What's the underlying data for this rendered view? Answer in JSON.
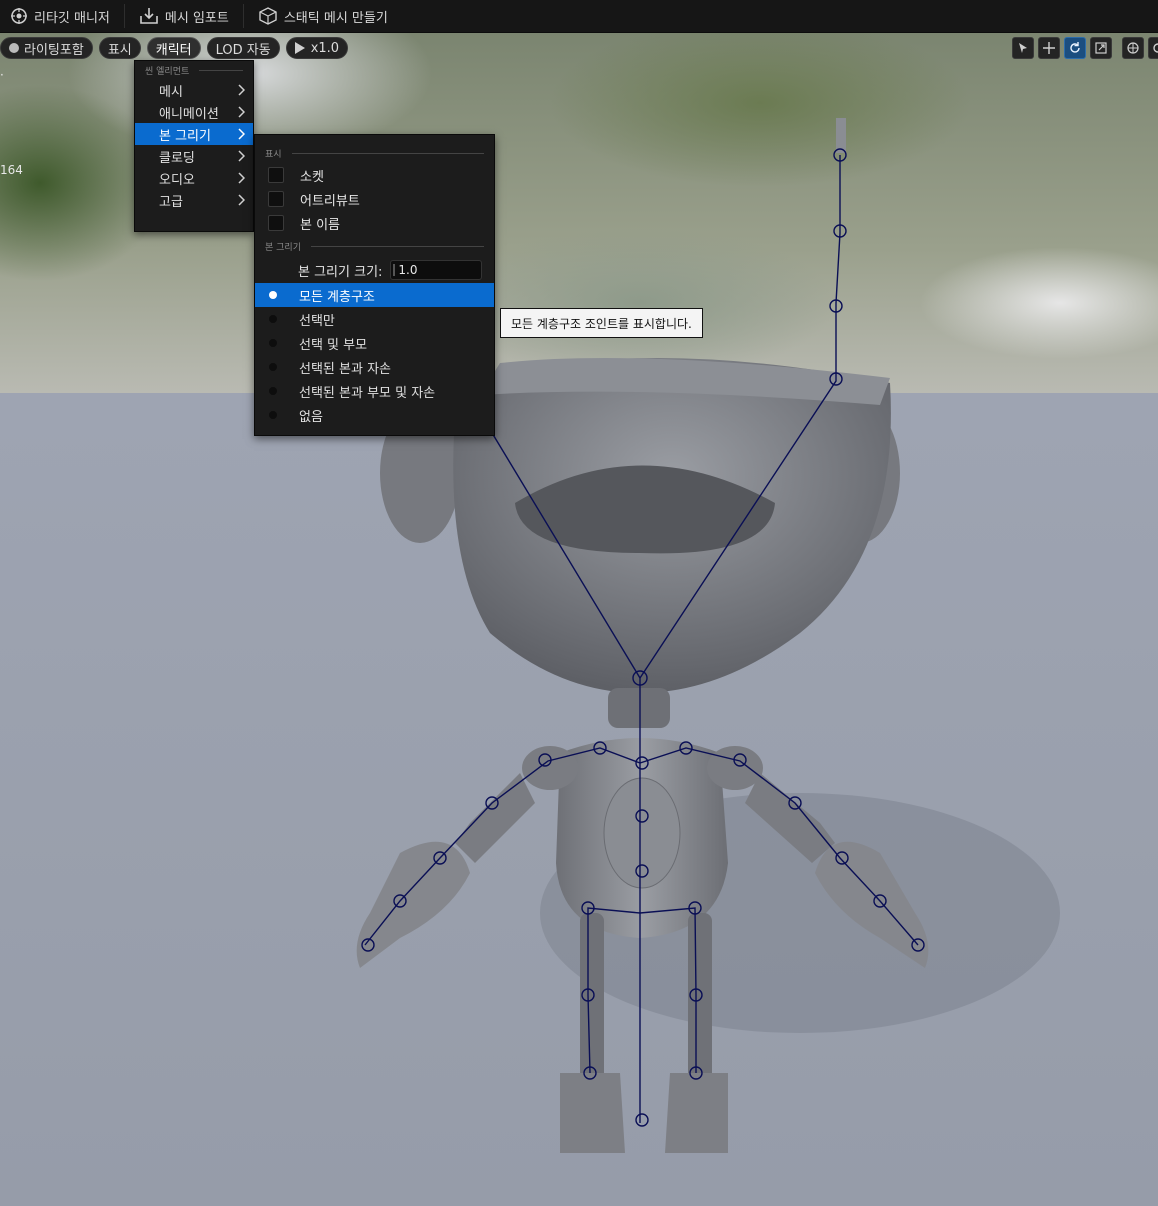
{
  "topbar": {
    "retarget_manager": "리타깃 매니저",
    "import_mesh": "메시 임포트",
    "make_static_mesh": "스태틱 메시 만들기"
  },
  "viewport_toolbar": {
    "lighting": "라이팅포함",
    "show": "표시",
    "character": "캐릭터",
    "lod": "LOD 자동",
    "play_speed": "x1.0"
  },
  "side_readout": "164",
  "character_menu": {
    "section": "씬 엘리먼트",
    "items": [
      {
        "label": "메시"
      },
      {
        "label": "애니메이션"
      },
      {
        "label": "본 그리기"
      },
      {
        "label": "클로딩"
      },
      {
        "label": "오디오"
      },
      {
        "label": "고급"
      }
    ]
  },
  "bone_menu": {
    "section_show": "표시",
    "checks": [
      "소켓",
      "어트리뷰트",
      "본 이름"
    ],
    "section_draw": "본 그리기",
    "size_label": "본 그리기 크기:",
    "size_value": "1.0",
    "radios": [
      "모든 계층구조",
      "선택만",
      "선택 및 부모",
      "선택된 본과 자손",
      "선택된 본과 부모 및 자손",
      "없음"
    ]
  },
  "tooltip": "모든 계층구조 조인트를 표시합니다."
}
